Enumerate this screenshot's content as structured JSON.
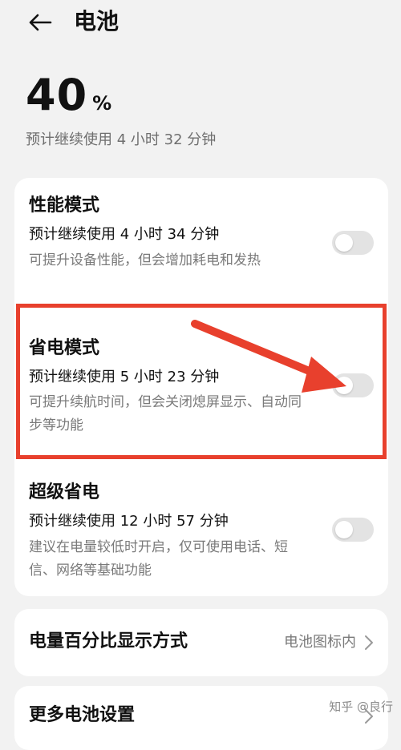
{
  "header": {
    "title": "电池"
  },
  "battery": {
    "percent": "40",
    "unit": "%",
    "estimate": "预计继续使用 4 小时 32 分钟"
  },
  "modes": [
    {
      "title": "性能模式",
      "estimate": "预计继续使用 4 小时 34 分钟",
      "description": "可提升设备性能，但会增加耗电和发热",
      "enabled": false
    },
    {
      "title": "省电模式",
      "estimate": "预计继续使用 5 小时 23 分钟",
      "description": "可提升续航时间，但会关闭熄屏显示、自动同步等功能",
      "enabled": false
    },
    {
      "title": "超级省电",
      "estimate": "预计继续使用 12 小时 57 分钟",
      "description": "建议在电量较低时开启，仅可使用电话、短信、网络等基础功能",
      "enabled": false
    }
  ],
  "percent_display": {
    "label": "电量百分比显示方式",
    "value": "电池图标内"
  },
  "more_settings": {
    "label": "更多电池设置"
  },
  "watermark": "知乎 @良行",
  "colors": {
    "background": "#f2f2f2",
    "card": "#ffffff",
    "highlight": "#e8402d",
    "toggle_off": "#e3e3e3"
  }
}
